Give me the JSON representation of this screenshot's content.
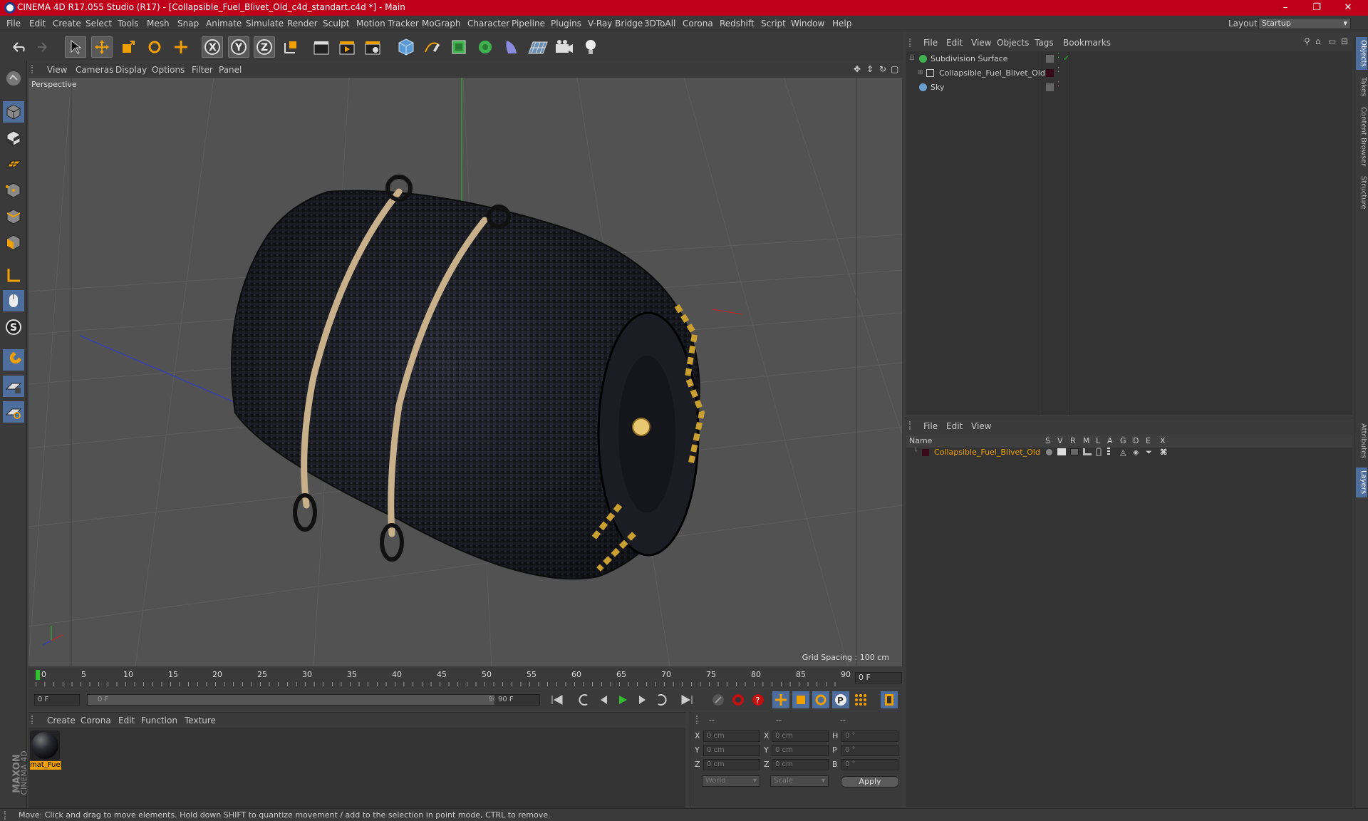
{
  "window": {
    "title": "CINEMA 4D R17.055 Studio (R17) - [Collapsible_Fuel_Blivet_Old_c4d_standart.c4d *] - Main",
    "controls": [
      "–",
      "❐",
      "✕"
    ]
  },
  "menubar": {
    "items": [
      "File",
      "Edit",
      "Create",
      "Select",
      "Tools",
      "Mesh",
      "Snap",
      "Animate",
      "Simulate",
      "Render",
      "Sculpt",
      "Motion Tracker",
      "MoGraph",
      "Character",
      "Pipeline",
      "Plugins",
      "V-Ray Bridge",
      "3DToAll",
      "Corona",
      "Redshift",
      "Script",
      "Window",
      "Help"
    ],
    "layout_label": "Layout:",
    "layout_value": "Startup"
  },
  "viewport": {
    "menu": [
      "View",
      "Cameras",
      "Display",
      "Options",
      "Filter",
      "Panel"
    ],
    "label": "Perspective",
    "grid_spacing": "Grid Spacing : 100 cm"
  },
  "timeline": {
    "ticks": [
      "0",
      "5",
      "10",
      "15",
      "20",
      "25",
      "30",
      "35",
      "40",
      "45",
      "50",
      "55",
      "60",
      "65",
      "70",
      "75",
      "80",
      "85",
      "90"
    ],
    "current_frame": "0 F"
  },
  "transport": {
    "start": "0 F",
    "range_start": "0 F",
    "range_end": "90 F",
    "end": "90 F"
  },
  "material_manager": {
    "menu": [
      "Create",
      "Corona",
      "Edit",
      "Function",
      "Texture"
    ],
    "materials": [
      {
        "name": "mat_Fuel"
      }
    ]
  },
  "coordinates": {
    "col_headers": [
      "--",
      "--",
      "--"
    ],
    "rows": [
      {
        "a": "X",
        "av": "0 cm",
        "b": "X",
        "bv": "0 cm",
        "c": "H",
        "cv": "0 °"
      },
      {
        "a": "Y",
        "av": "0 cm",
        "b": "Y",
        "bv": "0 cm",
        "c": "P",
        "cv": "0 °"
      },
      {
        "a": "Z",
        "av": "0 cm",
        "b": "Z",
        "bv": "0 cm",
        "c": "B",
        "cv": "0 °"
      }
    ],
    "space": "World",
    "mode": "Scale",
    "apply": "Apply"
  },
  "object_manager": {
    "menu": [
      "File",
      "Edit",
      "View",
      "Objects",
      "Tags",
      "Bookmarks"
    ],
    "objects": [
      {
        "name": "Subdivision Surface"
      },
      {
        "name": "Collapsible_Fuel_Blivet_Old"
      },
      {
        "name": "Sky"
      }
    ]
  },
  "layer_manager": {
    "menu": [
      "File",
      "Edit",
      "View"
    ],
    "columns": [
      "Name",
      "S",
      "V",
      "R",
      "M",
      "L",
      "A",
      "G",
      "D",
      "E",
      "X"
    ],
    "layers": [
      {
        "name": "Collapsible_Fuel_Blivet_Old",
        "color": "#f0a000"
      }
    ]
  },
  "right_tabs": [
    "Objects",
    "Takes",
    "Content Browser",
    "Structure",
    "Attributes",
    "Layers"
  ],
  "status": {
    "text": "Move: Click and drag to move elements. Hold down SHIFT to quantize movement / add to the selection in point mode, CTRL to remove."
  },
  "brand": {
    "maxon": "MAXON",
    "cinema": "CINEMA 4D"
  },
  "colors": {
    "title_bar": "#c0001a",
    "accent": "#f0a000",
    "selected": "#4e6f9e"
  }
}
